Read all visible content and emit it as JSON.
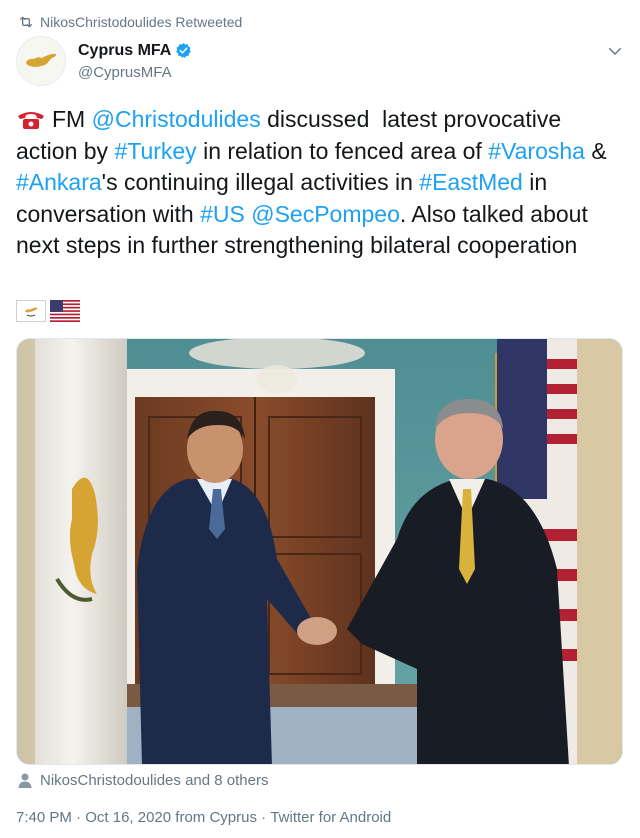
{
  "retweet": {
    "text": "NikosChristodoulides Retweeted",
    "icon": "retweet-icon"
  },
  "author": {
    "name": "Cyprus MFA",
    "handle": "@CyprusMFA",
    "verified": true,
    "avatar_icon": "cyprus-map-logo"
  },
  "tweet": {
    "emoji_phone": "telephone-icon",
    "parts": [
      {
        "t": "FM ",
        "link": false
      },
      {
        "t": "@Christodulides",
        "link": true
      },
      {
        "t": " discussed  latest provocative action by ",
        "link": false
      },
      {
        "t": "#Turkey",
        "link": true
      },
      {
        "t": " in relation to fenced area of ",
        "link": false
      },
      {
        "t": "#Varosha",
        "link": true
      },
      {
        "t": " & ",
        "link": false
      },
      {
        "t": "#Ankara",
        "link": true
      },
      {
        "t": "'s continuing illegal activities in ",
        "link": false
      },
      {
        "t": "#EastMed",
        "link": true
      },
      {
        "t": " in conversation with ",
        "link": false
      },
      {
        "t": "#US",
        "link": true
      },
      {
        "t": " ",
        "link": false
      },
      {
        "t": "@SecPompeo",
        "link": true
      },
      {
        "t": ". Also talked about next steps in further strengthening bilateral cooperation",
        "link": false
      }
    ],
    "flags": [
      "flag-cyprus",
      "flag-usa"
    ]
  },
  "photo": {
    "subject": "two men shaking hands between Cyprus and US flags"
  },
  "likers": {
    "text": "NikosChristodoulides and 8 others"
  },
  "meta": {
    "time": "7:40 PM",
    "sep1": " · ",
    "date": "Oct 16, 2020",
    "location": " from Cyprus",
    "sep2": " · ",
    "client": "Twitter for Android"
  },
  "colors": {
    "link": "#1da1f2",
    "text": "#14171a",
    "muted": "#657786",
    "verified": "#1da1f2"
  }
}
